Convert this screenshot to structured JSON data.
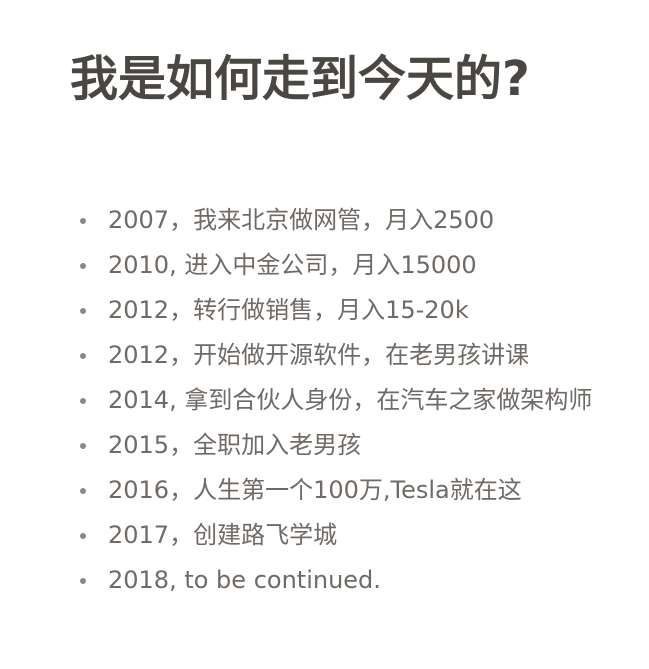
{
  "slide": {
    "title": "我是如何走到今天的?",
    "items": [
      "2007，我来北京做网管，月入2500",
      "2010, 进入中金公司，月入15000",
      "2012，转行做销售，月入15-20k",
      "2012，开始做开源软件，在老男孩讲课",
      "2014, 拿到合伙人身份，在汽车之家做架构师",
      "2015，全职加入老男孩",
      "2016，人生第一个100万,Tesla就在这",
      "2017，创建路飞学城",
      "2018, to be continued."
    ]
  },
  "colors": {
    "title": "#4a4642",
    "text": "#6f6a66",
    "bullet": "#8c8782",
    "background": "#ffffff"
  }
}
